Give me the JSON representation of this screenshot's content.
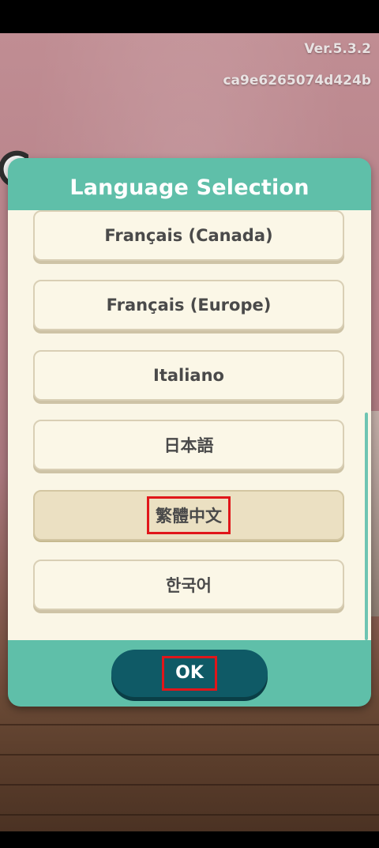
{
  "header": {
    "version": "Ver.5.3.2",
    "build_hash": "ca9e6265074d424b"
  },
  "dialog": {
    "title": "Language Selection",
    "languages": [
      {
        "label": "Français (Canada)",
        "selected": false
      },
      {
        "label": "Français (Europe)",
        "selected": false
      },
      {
        "label": "Italiano",
        "selected": false
      },
      {
        "label": "日本語",
        "selected": false
      },
      {
        "label": "繁體中文",
        "selected": true
      },
      {
        "label": "한국어",
        "selected": false
      }
    ],
    "ok_label": "OK"
  },
  "colors": {
    "dialog_teal": "#5fbfa9",
    "list_background": "#faf6e6",
    "ok_button": "#0f5a66",
    "selected_item": "#ebe0c2",
    "highlight_red": "#e0161a"
  }
}
